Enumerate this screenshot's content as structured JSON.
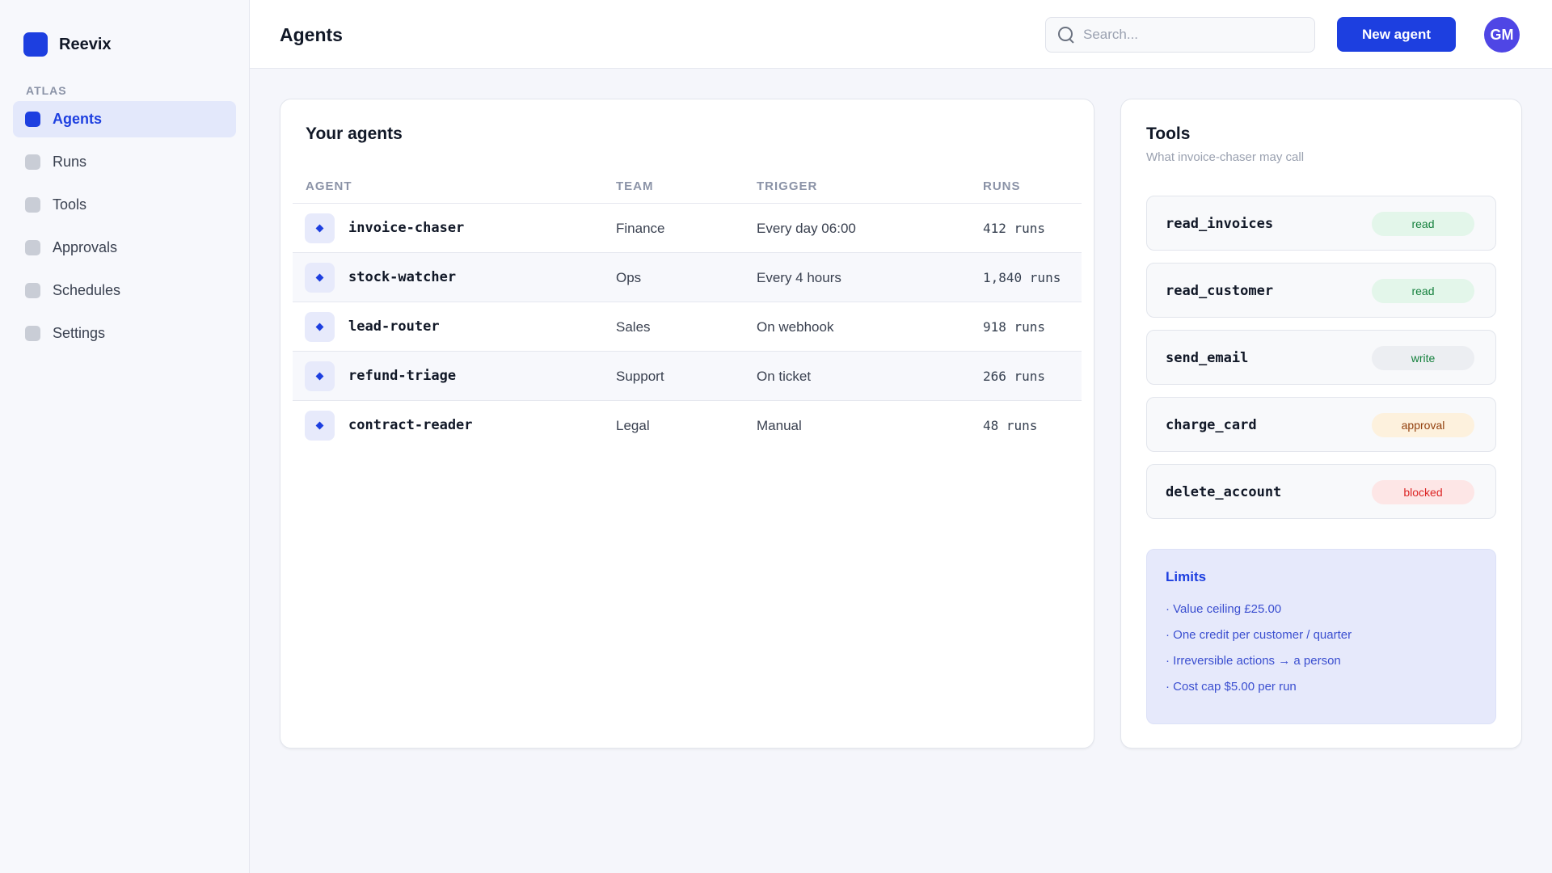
{
  "brand": {
    "name": "Reevix"
  },
  "sidebar": {
    "section_label": "ATLAS",
    "items": [
      {
        "label": "Agents",
        "active": true
      },
      {
        "label": "Runs",
        "active": false
      },
      {
        "label": "Tools",
        "active": false
      },
      {
        "label": "Approvals",
        "active": false
      },
      {
        "label": "Schedules",
        "active": false
      },
      {
        "label": "Settings",
        "active": false
      }
    ]
  },
  "header": {
    "title": "Agents",
    "search_placeholder": "Search...",
    "new_agent_label": "New agent",
    "avatar_initials": "GM"
  },
  "agents": {
    "title": "Your agents",
    "columns": [
      "AGENT",
      "TEAM",
      "TRIGGER",
      "RUNS"
    ],
    "rows": [
      {
        "name": "invoice-chaser",
        "team": "Finance",
        "trigger": "Every day 06:00",
        "runs": "412 runs"
      },
      {
        "name": "stock-watcher",
        "team": "Ops",
        "trigger": "Every 4 hours",
        "runs": "1,840 runs"
      },
      {
        "name": "lead-router",
        "team": "Sales",
        "trigger": "On webhook",
        "runs": "918 runs"
      },
      {
        "name": "refund-triage",
        "team": "Support",
        "trigger": "On ticket",
        "runs": "266 runs"
      },
      {
        "name": "contract-reader",
        "team": "Legal",
        "trigger": "Manual",
        "runs": "48 runs"
      }
    ]
  },
  "tools": {
    "title": "Tools",
    "subtitle": "What invoice-chaser may call",
    "items": [
      {
        "name": "read_invoices",
        "permission": "read"
      },
      {
        "name": "read_customer",
        "permission": "read"
      },
      {
        "name": "send_email",
        "permission": "write"
      },
      {
        "name": "charge_card",
        "permission": "approval"
      },
      {
        "name": "delete_account",
        "permission": "blocked"
      }
    ]
  },
  "limits": {
    "title": "Limits",
    "items": [
      "· Value ceiling £25.00",
      "· One credit per customer / quarter",
      "· Irreversible actions → a person",
      "· Cost cap $5.00 per run"
    ]
  },
  "colors": {
    "accent": "#1d3fe0",
    "avatar": "#4f46e5",
    "read": "#15803d",
    "approval": "#92400e",
    "blocked": "#dc2626"
  }
}
